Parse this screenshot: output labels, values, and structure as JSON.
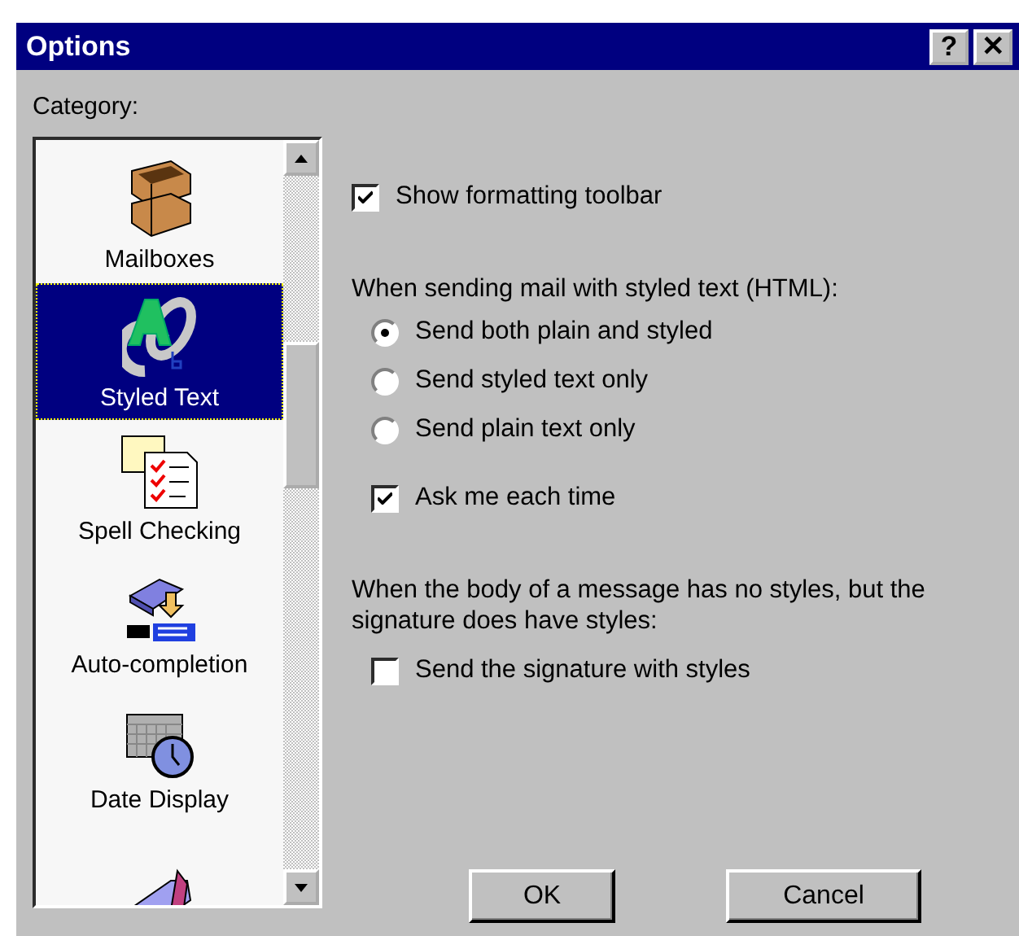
{
  "window": {
    "title": "Options",
    "title_buttons": [
      "?",
      "✕"
    ]
  },
  "category": {
    "label": "Category:",
    "items": [
      {
        "label": "Mailboxes",
        "kind": "mailboxes",
        "selected": false
      },
      {
        "label": "Styled Text",
        "kind": "styled",
        "selected": true
      },
      {
        "label": "Spell Checking",
        "kind": "spell",
        "selected": false
      },
      {
        "label": "Auto-completion",
        "kind": "auto",
        "selected": false
      },
      {
        "label": "Date Display",
        "kind": "date",
        "selected": false
      },
      {
        "kind": "label",
        "selected": false
      }
    ]
  },
  "options": [
    {
      "kind": "checkbox",
      "label": "Show formatting toolbar",
      "checked": true
    },
    {
      "kind": "heading",
      "label": "When sending mail with styled text (HTML):"
    },
    {
      "kind": "radio",
      "label": "Send both plain and styled",
      "selected": true
    },
    {
      "kind": "radio",
      "label": "Send styled text only",
      "selected": false
    },
    {
      "kind": "radio",
      "label": "Send plain text only",
      "selected": false
    },
    {
      "kind": "subcheckbox",
      "label": "Ask me each time",
      "checked": true
    },
    {
      "kind": "heading",
      "label": "When the body of a message has no styles, but the signature does have styles:"
    },
    {
      "kind": "subcheckbox",
      "label": "Send the signature with styles",
      "checked": false
    }
  ],
  "buttons": [
    "OK",
    "Cancel"
  ]
}
